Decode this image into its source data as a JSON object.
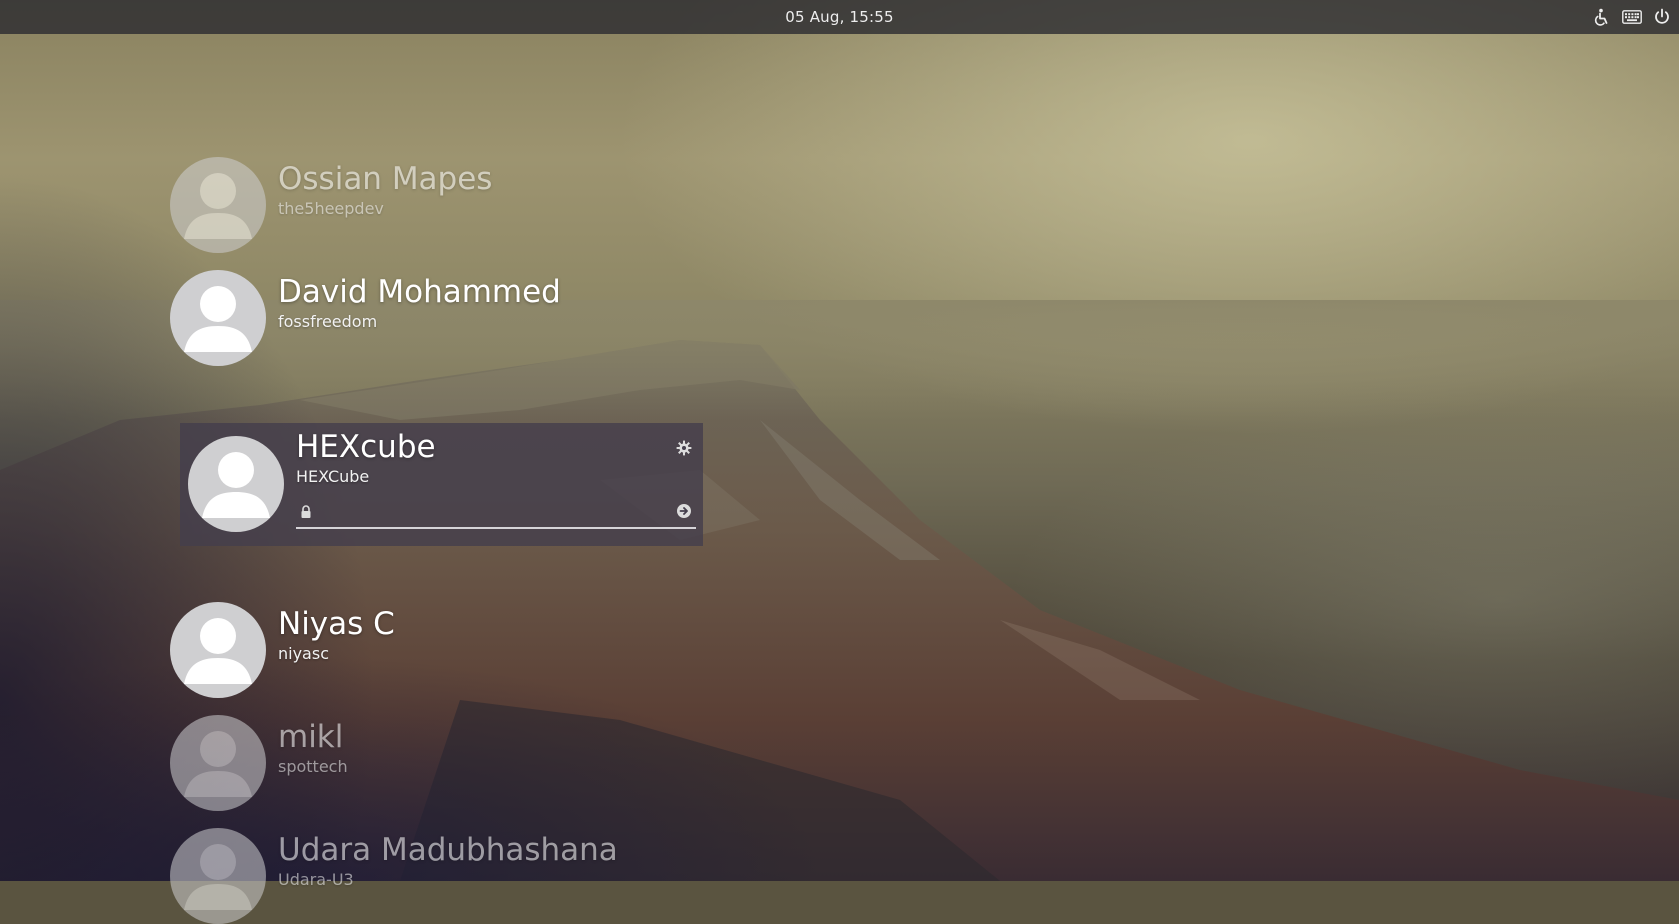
{
  "topbar": {
    "clock": "05 Aug, 15:55",
    "tray_icons": [
      "accessibility-icon",
      "keyboard-icon",
      "power-icon"
    ]
  },
  "users": [
    {
      "name": "Ossian Mapes",
      "login": "the5heepdev",
      "dimmed": true
    },
    {
      "name": "David Mohammed",
      "login": "fossfreedom",
      "dimmed": false
    },
    {
      "name": "HEXcube",
      "login": "HEXCube",
      "selected": true
    },
    {
      "name": "Niyas C",
      "login": "niyasc",
      "dimmed": false
    },
    {
      "name": "mikl",
      "login": "spottech",
      "dimmed": true
    },
    {
      "name": "Udara Madubhashana",
      "login": "Udara-U3",
      "dimmed": true
    }
  ],
  "login_form": {
    "password_value": "",
    "password_placeholder": ""
  },
  "colors": {
    "topbar_bg": "#2a2a30",
    "card_bg": "#443e4c",
    "avatar": "#cfcfd1",
    "text": "#ffffff"
  }
}
